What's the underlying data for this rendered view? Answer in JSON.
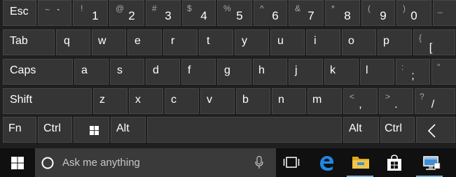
{
  "keyboard": {
    "row1": [
      {
        "label": "Esc"
      },
      {
        "shift": "~",
        "extra": "`"
      },
      {
        "shift": "!",
        "num": "1"
      },
      {
        "shift": "@",
        "num": "2"
      },
      {
        "shift": "#",
        "num": "3"
      },
      {
        "shift": "$",
        "num": "4"
      },
      {
        "shift": "%",
        "num": "5"
      },
      {
        "shift": "^",
        "num": "6"
      },
      {
        "shift": "&",
        "num": "7"
      },
      {
        "shift": "*",
        "num": "8"
      },
      {
        "shift": "(",
        "num": "9"
      },
      {
        "shift": ")",
        "num": "0"
      },
      {
        "shift": "_",
        "num": ""
      }
    ],
    "row2": {
      "tab": "Tab",
      "letters": [
        "q",
        "w",
        "e",
        "r",
        "t",
        "y",
        "u",
        "i",
        "o",
        "p"
      ],
      "bracket_shift": "{",
      "bracket": "["
    },
    "row3": {
      "caps": "Caps",
      "letters": [
        "a",
        "s",
        "d",
        "f",
        "g",
        "h",
        "j",
        "k",
        "l"
      ],
      "semi_shift": ":",
      "semi": ";",
      "quote_shift": "\"",
      "quote": ""
    },
    "row4": {
      "shift": "Shift",
      "letters": [
        "z",
        "x",
        "c",
        "v",
        "b",
        "n",
        "m"
      ],
      "comma_shift": "<",
      "comma": ",",
      "period_shift": ">",
      "period": ".",
      "slash_shift": "?",
      "slash": "/"
    },
    "row5": {
      "fn": "Fn",
      "ctrl_left": "Ctrl",
      "alt_left": "Alt",
      "alt_right": "Alt",
      "ctrl_right": "Ctrl"
    }
  },
  "taskbar": {
    "search_placeholder": "Ask me anything",
    "icons": [
      "windows-start-icon",
      "cortana-circle-icon",
      "microphone-icon",
      "task-view-icon",
      "edge-browser-icon",
      "file-explorer-icon",
      "store-icon",
      "remote-desktop-icon"
    ]
  },
  "colors": {
    "key_bg": "#353535",
    "keyboard_bg": "#1f1f1f",
    "taskbar_bg": "#101010",
    "search_bg": "#3a3a3a",
    "edge_blue": "#1e88e5",
    "folder_yellow": "#f3c546"
  }
}
